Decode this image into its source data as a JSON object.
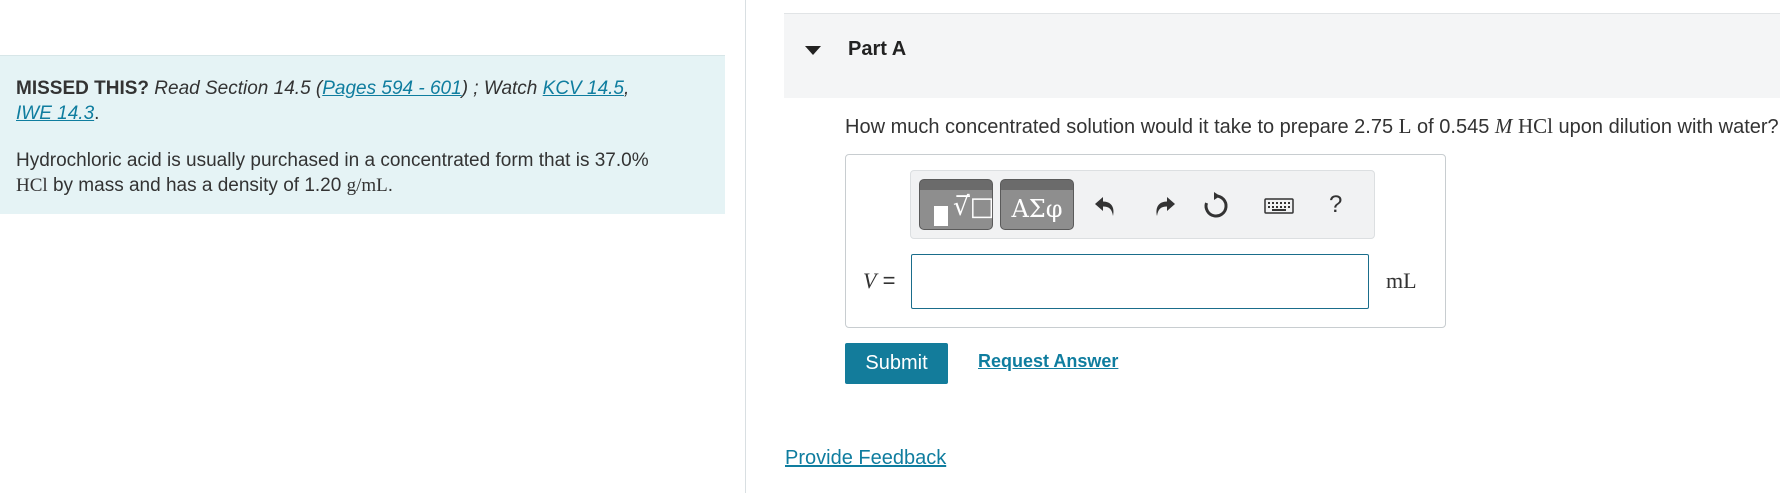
{
  "hint": {
    "missed_label": "MISSED THIS?",
    "read_text": "Read Section 14.5 (",
    "pages_link": "Pages 594 - 601",
    "watch_text": ") ; Watch ",
    "kcv_link": "KCV 14.5",
    "comma": ",",
    "iwe_link": "IWE 14.3",
    "period": ".",
    "problem_text_1": "Hydrochloric acid is usually purchased in a concentrated form that is 37.0%",
    "problem_hcl": "HCl",
    "problem_text_2": " by mass and has a density of 1.20 ",
    "problem_unit": "g/mL",
    "problem_end": "."
  },
  "part": {
    "title": "Part A",
    "question_1": "How much concentrated solution would it take to prepare 2.75 ",
    "question_L": "L",
    "question_2": " of 0.545 ",
    "question_M": "M",
    "question_HCl": "HCl",
    "question_3": " upon dilution with water?"
  },
  "toolbar": {
    "templates_icon": "radical-template-icon",
    "symbols_label": "ΑΣφ",
    "undo_icon": "undo-icon",
    "redo_icon": "redo-icon",
    "reset_icon": "reset-icon",
    "keyboard_icon": "keyboard-icon",
    "help_label": "?"
  },
  "answer": {
    "variable": "V",
    "equals": " =",
    "value": "",
    "unit": "mL"
  },
  "actions": {
    "submit_label": "Submit",
    "request_answer_label": "Request Answer",
    "feedback_label": "Provide Feedback"
  },
  "colors": {
    "hint_background": "#e5f3f5",
    "link": "#0f7d9f",
    "submit_background": "#137c9b",
    "header_background": "#f4f5f6"
  }
}
